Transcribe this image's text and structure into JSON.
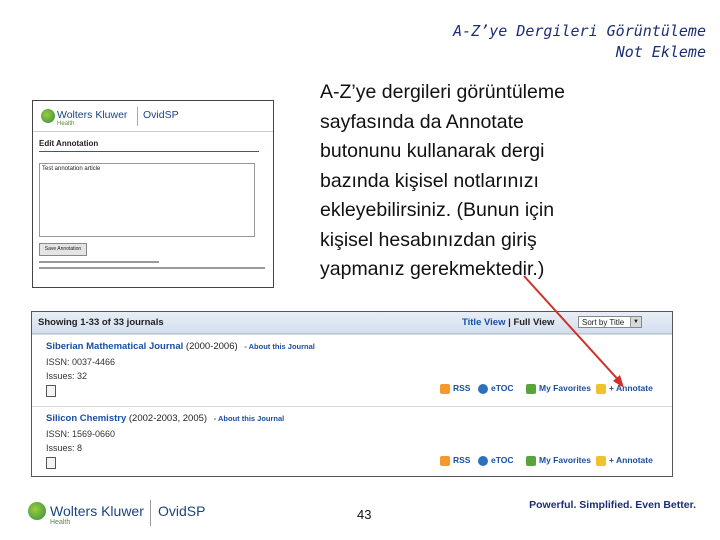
{
  "slide": {
    "title_line1": "A-Z’ye Dergileri Görüntüleme",
    "title_line2": "Not Ekleme",
    "body_lines": [
      "A-Z’ye dergileri görüntüleme",
      "sayfasında da Annotate",
      "butonunu kullanarak dergi",
      "bazında kişisel notlarınızı",
      "ekleyebilirsiniz. (Bunun için",
      "kişisel hesabınızdan giriş",
      "yapmanız gerekmektedir.)"
    ],
    "page_number": "43",
    "tagline": "Powerful. Simplified. Even Better.",
    "footer_brand": "Wolters Kluwer",
    "footer_brand_sub": "Health",
    "footer_product": "OvidSP",
    "arrow_color": "#d0302a"
  },
  "annotation_screenshot": {
    "brand": "Wolters Kluwer",
    "brand_sub": "Health",
    "product": "OvidSP",
    "heading": "Edit Annotation",
    "textarea_value": "Test annotation article",
    "button_label": "Save Annotation"
  },
  "journals_screenshot": {
    "showing": "Showing 1-33 of 33 journals",
    "title_view": "Title View",
    "separator": "|",
    "full_view": "Full View",
    "select_value": "Sort by Title",
    "journals": [
      {
        "title": "Siberian Mathematical Journal",
        "years": "(2000-2006)",
        "about": "- About this Journal",
        "issn": "ISSN: 0037-4466",
        "issues": "Issues: 32",
        "actions": [
          "RSS",
          "eTOC",
          "My Favorites",
          "+ Annotate"
        ]
      },
      {
        "title": "Silicon Chemistry",
        "years": "(2002-2003, 2005)",
        "about": "- About this Journal",
        "issn": "ISSN: 1569-0660",
        "issues": "Issues: 8",
        "actions": [
          "RSS",
          "eTOC",
          "My Favorites",
          "+ Annotate"
        ]
      }
    ]
  }
}
